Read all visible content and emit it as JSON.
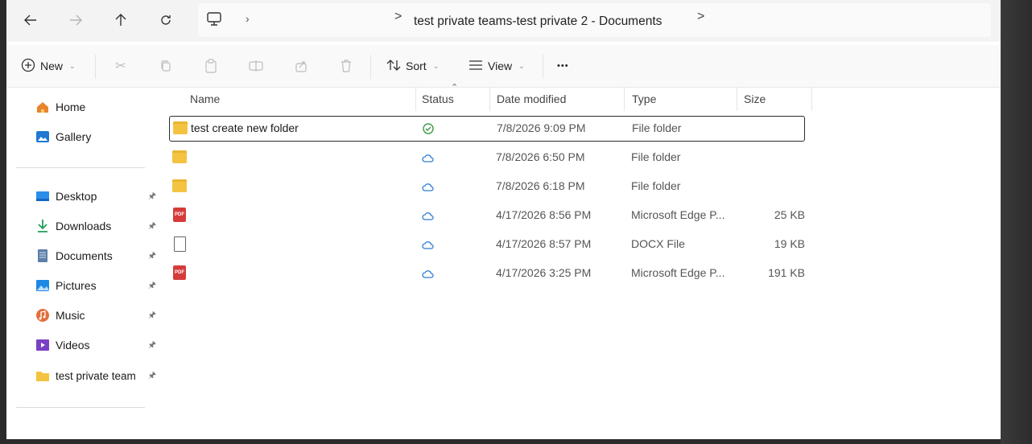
{
  "nav": {
    "back_icon": "back-arrow-icon",
    "forward_icon": "forward-arrow-icon",
    "up_icon": "up-arrow-icon",
    "refresh_icon": "refresh-icon",
    "pc_icon": "computer-icon"
  },
  "breadcrumb": {
    "separator": ">",
    "path": "test private teams-test private 2 - Documents"
  },
  "command_bar": {
    "new_label": "New",
    "sort_label": "Sort",
    "view_label": "View",
    "more_label": "•••"
  },
  "sidebar": {
    "top_items": [
      {
        "label": "Home",
        "icon": "home-icon"
      },
      {
        "label": "Gallery",
        "icon": "gallery-icon"
      }
    ],
    "pinned_items": [
      {
        "label": "Desktop",
        "icon": "desktop-icon"
      },
      {
        "label": "Downloads",
        "icon": "downloads-icon"
      },
      {
        "label": "Documents",
        "icon": "documents-icon"
      },
      {
        "label": "Pictures",
        "icon": "pictures-icon"
      },
      {
        "label": "Music",
        "icon": "music-icon"
      },
      {
        "label": "Videos",
        "icon": "videos-icon"
      },
      {
        "label": "test private team",
        "icon": "folder-icon"
      }
    ]
  },
  "columns": {
    "name": "Name",
    "status": "Status",
    "date_modified": "Date modified",
    "type": "Type",
    "size": "Size"
  },
  "files": [
    {
      "name": "test create new folder",
      "icon": "folder-icon",
      "status": "synced",
      "date": "7/8/2026 9:09 PM",
      "type": "File folder",
      "size": ""
    },
    {
      "name": "",
      "icon": "folder-icon",
      "status": "cloud",
      "date": "7/8/2026 6:50 PM",
      "type": "File folder",
      "size": ""
    },
    {
      "name": "",
      "icon": "folder-icon",
      "status": "cloud",
      "date": "7/8/2026 6:18 PM",
      "type": "File folder",
      "size": ""
    },
    {
      "name": "",
      "icon": "pdf-icon",
      "status": "cloud",
      "date": "4/17/2026 8:56 PM",
      "type": "Microsoft Edge P...",
      "size": "25 KB"
    },
    {
      "name": "",
      "icon": "docx-icon",
      "status": "cloud",
      "date": "4/17/2026 8:57 PM",
      "type": "DOCX File",
      "size": "19 KB"
    },
    {
      "name": "",
      "icon": "pdf-icon",
      "status": "cloud",
      "date": "4/17/2026 3:25 PM",
      "type": "Microsoft Edge P...",
      "size": "191 KB"
    }
  ],
  "colors": {
    "folder": "#f5c342",
    "pdf": "#d63b3b",
    "cloud": "#2f7fd1",
    "synced": "#3a9a4a"
  }
}
